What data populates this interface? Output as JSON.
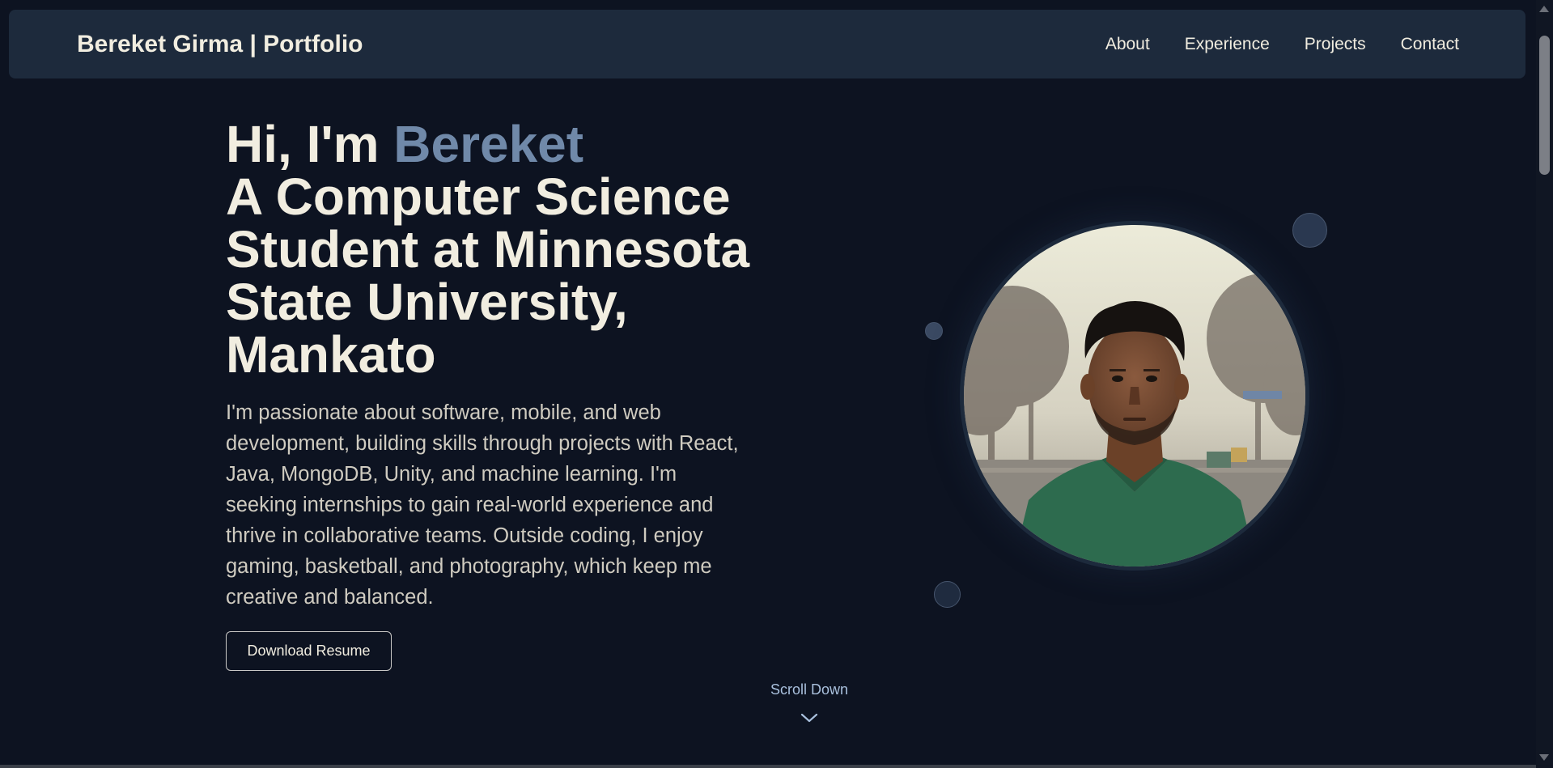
{
  "navbar": {
    "brand": "Bereket Girma | Portfolio",
    "links": [
      "About",
      "Experience",
      "Projects",
      "Contact"
    ]
  },
  "hero": {
    "greeting": "Hi, I'm ",
    "name": "Bereket",
    "tagline": "A Computer Science Student at Minnesota State University, Mankato",
    "description": "I'm passionate about software, mobile, and web development, building skills through projects with React, Java, MongoDB, Unity, and machine learning. I'm seeking internships to gain real-world experience and thrive in collaborative teams. Outside coding, I enjoy gaming, basketball, and photography, which keep me creative and balanced.",
    "resume_button": "Download Resume",
    "accent_color": "#7089a9"
  },
  "scroll": {
    "label": "Scroll Down",
    "icon": "chevron-down-icon"
  },
  "colors": {
    "background": "#0d1321",
    "navbar": "#1d2a3c",
    "text": "#f1ede0",
    "scroll_label": "#a9c0dd"
  }
}
